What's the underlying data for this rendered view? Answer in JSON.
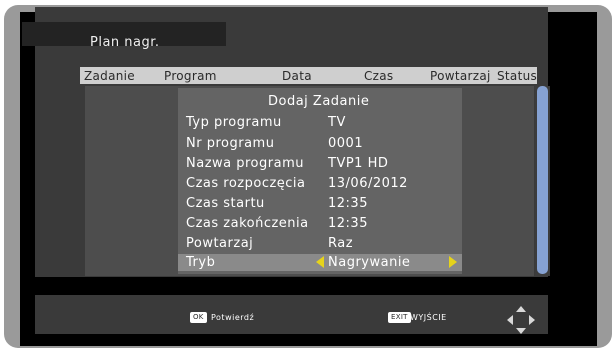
{
  "window": {
    "title": "Plan nagr."
  },
  "columns": [
    "Zadanie",
    "Program",
    "Data",
    "Czas",
    "Powtarzaj",
    "Status"
  ],
  "dialog": {
    "title": "Dodaj Zadanie",
    "rows": [
      {
        "label": "Typ programu",
        "value": "TV"
      },
      {
        "label": "Nr programu",
        "value": "0001"
      },
      {
        "label": "Nazwa programu",
        "value": "TVP1 HD"
      },
      {
        "label": "Czas rozpoczęcia",
        "value": "13/06/2012"
      },
      {
        "label": "Czas startu",
        "value": "12:35"
      },
      {
        "label": "Czas zakończenia",
        "value": "12:35"
      },
      {
        "label": "Powtarzaj",
        "value": "Raz"
      },
      {
        "label": "Tryb",
        "value": "Nagrywanie"
      }
    ]
  },
  "footer": {
    "ok_key": "OK",
    "ok_label": "Potwierdź",
    "exit_key": "EXIT",
    "exit_label": "WYJŚCIE"
  },
  "colors": {
    "accent_arrow": "#e6d31b",
    "scroll_thumb": "#86a2d3"
  },
  "icons": [
    "arrow-left-icon",
    "arrow-right-icon",
    "dpad-navigation-icon"
  ]
}
